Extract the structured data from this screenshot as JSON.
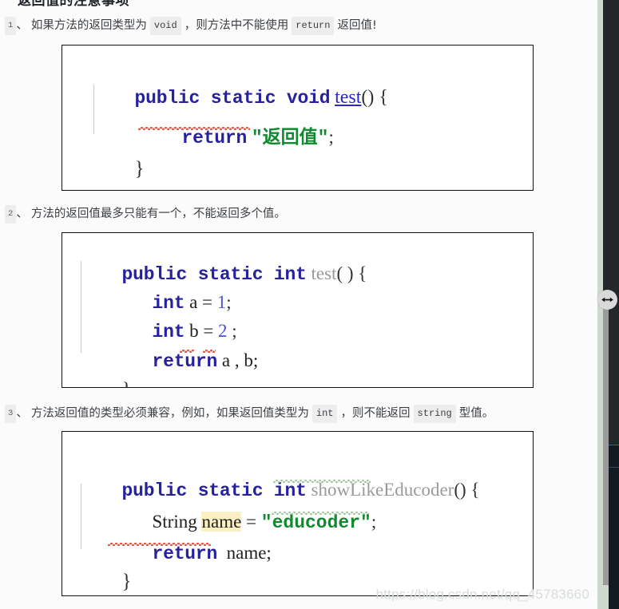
{
  "page": {
    "background": "#fbfbfb",
    "heading_sliver": "返回值的注意事项",
    "watermark": "https://blog.csdn.net/qq_45783660"
  },
  "notes": [
    {
      "number": "1",
      "separator": "、",
      "parts": [
        {
          "type": "text",
          "value": "如果方法的返回类型为"
        },
        {
          "type": "code",
          "value": "void"
        },
        {
          "type": "text",
          "value": "，则方法中不能使用"
        },
        {
          "type": "code",
          "value": "return"
        },
        {
          "type": "text",
          "value": "返回值!"
        }
      ]
    },
    {
      "number": "2",
      "separator": "、",
      "parts": [
        {
          "type": "text",
          "value": "方法的返回值最多只能有一个，不能返回多个值。"
        }
      ]
    },
    {
      "number": "3",
      "separator": "、",
      "parts": [
        {
          "type": "text",
          "value": "方法返回值的类型必须兼容，例如，如果返回值类型为"
        },
        {
          "type": "code",
          "value": "int"
        },
        {
          "type": "text",
          "value": "，则不能返回"
        },
        {
          "type": "code",
          "value": "string"
        },
        {
          "type": "text",
          "value": "型值。"
        }
      ]
    }
  ],
  "code_blocks": [
    {
      "id": "code-block-1",
      "lines": [
        "public static void test() {",
        "    return \"返回值\";",
        "}"
      ],
      "tokens": {
        "l1_kw": "public static void",
        "l1_method": "test",
        "l1_tail": "() {",
        "l2_kw": "return",
        "l2_str": "\"返回值\"",
        "l2_semi": ";",
        "l3": "}"
      }
    },
    {
      "id": "code-block-2",
      "lines": [
        "public static int test( ) {",
        "    int a = 1;",
        "    int b = 2 ;",
        "    return a , b;",
        "}"
      ],
      "tokens": {
        "l1_kw": "public static int",
        "l1_method": "test",
        "l1_tail": "( ) {",
        "l2_kw": "int",
        "l2_var": "a =",
        "l2_num": "1",
        "l2_semi": ";",
        "l3_kw": "int",
        "l3_var": "b =",
        "l3_num": "2",
        "l3_semi": ";",
        "l4_kw": "return",
        "l4_expr": "a , b;",
        "l5": "}"
      }
    },
    {
      "id": "code-block-3",
      "lines": [
        "public static int showLikeEducoder() {",
        "    String name = \"educoder\";",
        "    return name;",
        "}"
      ],
      "tokens": {
        "l1_kw": "public static int",
        "l1_method": "showLikeEducoder",
        "l1_tail": "() {",
        "l2_type": "String",
        "l2_name": "name",
        "l2_eq": "=",
        "l2_str": "\"educoder\"",
        "l2_semi": ";",
        "l3_kw": "return",
        "l3_var": "name;",
        "l4": "}"
      }
    }
  ],
  "right_rail": {
    "drag_handle_icon": "resize-horizontal-icon",
    "scrollbar_name": "vertical-scrollbar"
  }
}
